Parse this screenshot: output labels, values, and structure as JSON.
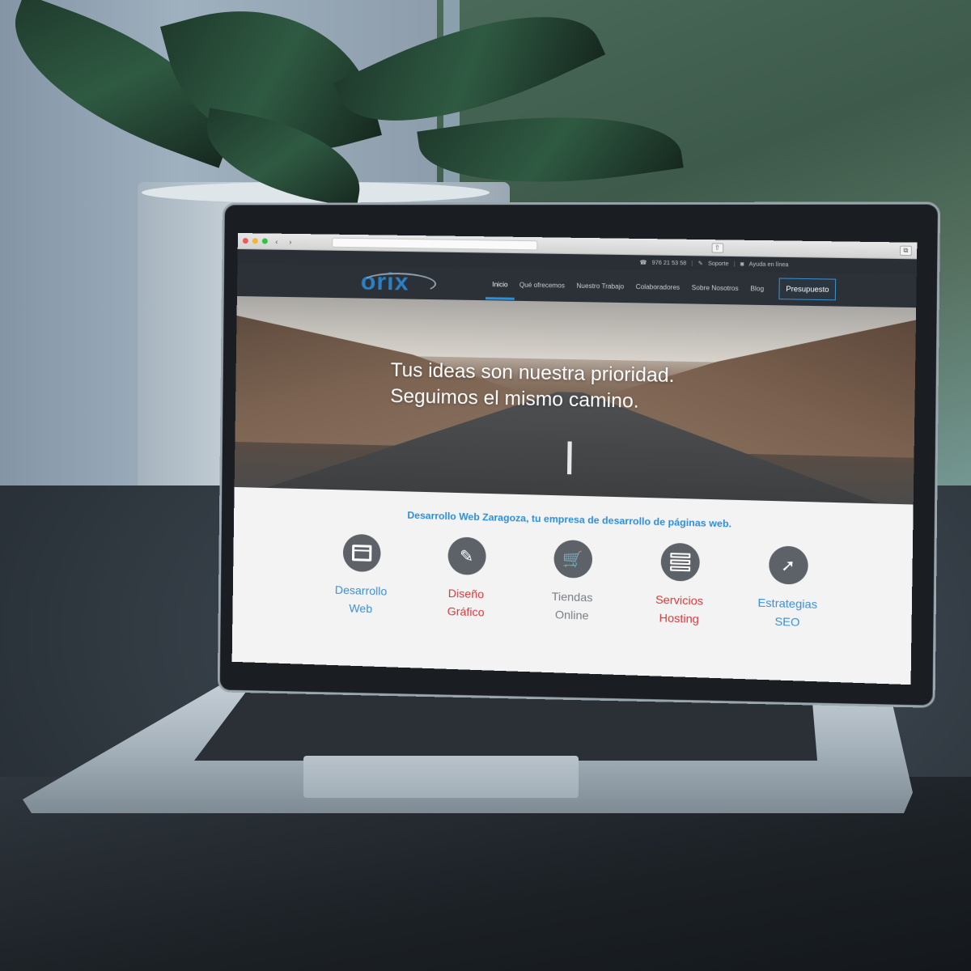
{
  "browser": {
    "back_arrow": "‹",
    "forward_arrow": "›"
  },
  "topbar": {
    "phone": "976 21 53 58",
    "support": "Soporte",
    "help": "Ayuda en línea"
  },
  "brand": {
    "logo_text": "orix"
  },
  "nav": {
    "items": [
      {
        "label": "Inicio"
      },
      {
        "label": "Qué ofrecemos"
      },
      {
        "label": "Nuestro Trabajo"
      },
      {
        "label": "Colaboradores"
      },
      {
        "label": "Sobre Nosotros"
      },
      {
        "label": "Blog"
      }
    ],
    "cta": "Presupuesto"
  },
  "hero": {
    "line1": "Tus ideas son nuestra prioridad.",
    "line2": "Seguimos el mismo camino."
  },
  "services": {
    "title": "Desarrollo Web Zaragoza, tu empresa de desarrollo de páginas web.",
    "items": [
      {
        "line1": "Desarrollo",
        "line2": "Web",
        "icon": "website-icon"
      },
      {
        "line1": "Diseño",
        "line2": "Gráfico",
        "icon": "design-icon"
      },
      {
        "line1": "Tiendas",
        "line2": "Online",
        "icon": "cart-icon"
      },
      {
        "line1": "Servicios",
        "line2": "Hosting",
        "icon": "server-icon"
      },
      {
        "line1": "Estrategias",
        "line2": "SEO",
        "icon": "rocket-icon"
      }
    ]
  },
  "colors": {
    "accent_blue": "#2b8fd8",
    "accent_red": "#d23a3a",
    "nav_bg": "#2b3137"
  }
}
